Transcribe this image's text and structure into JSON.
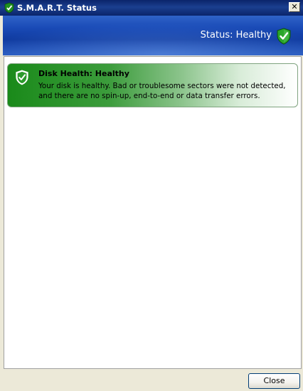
{
  "window": {
    "title": "S.M.A.R.T. Status",
    "close_glyph": "✕"
  },
  "header": {
    "status_text": "Status: Healthy",
    "icon": "shield-check-icon"
  },
  "health": {
    "title": "Disk Health: Healthy",
    "description": "Your disk is healthy. Bad or troublesome sectors were not detected, and there are no spin-up, end-to-end or data transfer errors.",
    "icon": "shield-check-icon",
    "color": "#1a8a1a"
  },
  "footer": {
    "close_label": "Close"
  }
}
